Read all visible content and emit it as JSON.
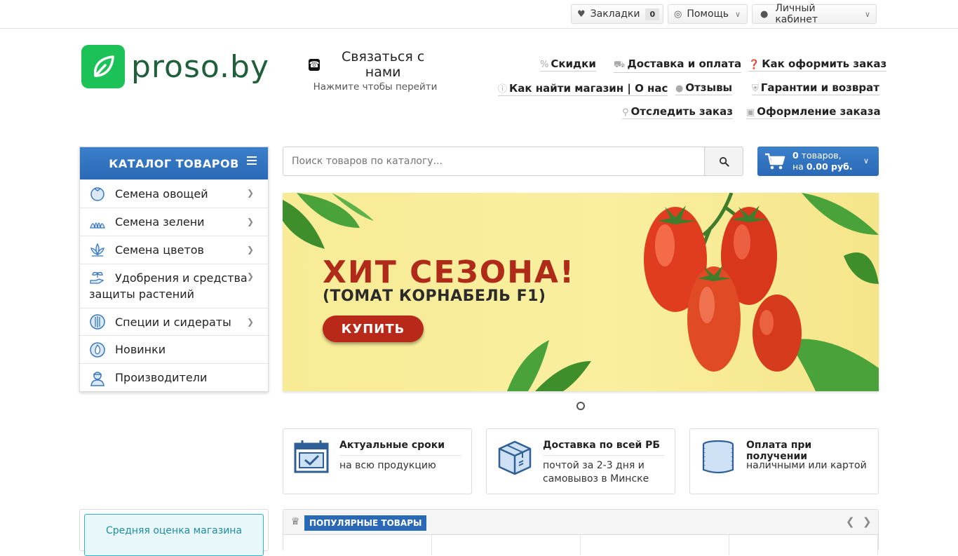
{
  "topbar": {
    "bookmarks_label": "Закладки",
    "bookmarks_count": "0",
    "help_label": "Помощь",
    "account_label": "Личный кабинет"
  },
  "header": {
    "logo_text": "proso.by",
    "contact_title": "Связаться с нами",
    "contact_sub": "Нажмите чтобы перейти",
    "links": [
      {
        "label": "Скидки",
        "icon": "percent-icon"
      },
      {
        "label": "Доставка и оплата",
        "icon": "truck-icon"
      },
      {
        "label": "Как оформить заказ",
        "icon": "question-icon"
      },
      {
        "label": "Как найти магазин | О нас",
        "icon": "info-icon"
      },
      {
        "label": "Отзывы",
        "icon": "comments-icon"
      },
      {
        "label": "Гарантии и возврат",
        "icon": "shield-icon"
      },
      {
        "label": "Отследить заказ",
        "icon": "search-icon"
      },
      {
        "label": "Оформление заказа",
        "icon": "basket-icon"
      }
    ]
  },
  "catalog": {
    "title": "КАТАЛОГ ТОВАРОВ",
    "items": [
      {
        "label": "Семена овощей",
        "icon": "tomato-icon"
      },
      {
        "label": "Семена зелени",
        "icon": "greens-icon"
      },
      {
        "label": "Семена цветов",
        "icon": "flower-icon"
      },
      {
        "label": "Удобрения и средства защиты растений",
        "icon": "seedling-hand-icon"
      },
      {
        "label": "Специи и сидераты",
        "icon": "spices-icon"
      },
      {
        "label": "Новинки",
        "icon": "new-icon"
      },
      {
        "label": "Производители",
        "icon": "manufacturer-icon"
      }
    ]
  },
  "search": {
    "placeholder": "Поиск товаров по каталогу..."
  },
  "cart": {
    "count": "0",
    "count_suffix": " товаров,",
    "total_prefix": "на ",
    "total": "0.00 руб."
  },
  "banner": {
    "title": "ХИТ СЕЗОНА!",
    "subtitle": "(ТОМАТ КОРНАБЕЛЬ F1)",
    "button": "КУПИТЬ"
  },
  "features": [
    {
      "title": "Актуальные сроки",
      "sub": "на всю продукцию",
      "icon": "calendar-check-icon"
    },
    {
      "title": "Доставка по всей РБ",
      "sub": "почтой за 2-3 дня и самовывоз в Минске",
      "icon": "box-icon"
    },
    {
      "title": "Оплата при получении",
      "sub": "наличными или картой",
      "icon": "coins-icon"
    }
  ],
  "rating": {
    "label": "Средняя оценка магазина"
  },
  "popular": {
    "label": "ПОПУЛЯРНЫЕ ТОВАРЫ"
  },
  "colors": {
    "accent_blue": "#2a69b6",
    "brand_green": "#1cc157",
    "banner_red": "#b02a1a"
  }
}
